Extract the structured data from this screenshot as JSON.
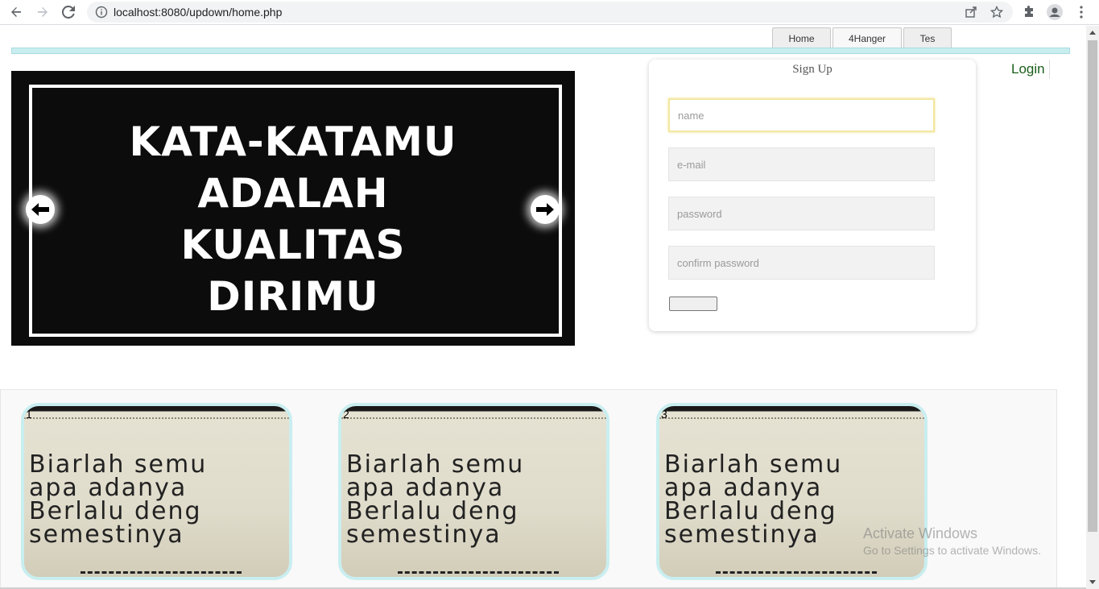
{
  "browser": {
    "url": "localhost:8080/updown/home.php"
  },
  "nav": {
    "tabs": [
      {
        "label": "Home"
      },
      {
        "label": "4Hanger"
      },
      {
        "label": "Tes"
      }
    ]
  },
  "slider": {
    "lines": [
      "KATA-KATAMU",
      "ADALAH",
      "KUALITAS",
      "DIRIMU"
    ]
  },
  "signup": {
    "title": "Sign Up",
    "fields": {
      "name_placeholder": "name",
      "email_placeholder": "e-mail",
      "password_placeholder": "password",
      "confirm_placeholder": "confirm password"
    },
    "submit_label": ""
  },
  "login_label": "Login",
  "gallery": {
    "items": [
      {
        "number": "1",
        "text": "Biarlah semu\napa adanya\nBerlalu deng\nsemestinya"
      },
      {
        "number": "2",
        "text": "Biarlah semu\napa adanya\nBerlalu deng\nsemestinya"
      },
      {
        "number": "3",
        "text": "Biarlah semu\napa adanya\nBerlalu deng\nsemestinya"
      }
    ]
  },
  "watermark": {
    "line1": "Activate Windows",
    "line2": "Go to Settings to activate Windows."
  },
  "colors": {
    "accent": "#c9eef0",
    "login": "#1a5e1a",
    "slider_bg": "#0c0c0c"
  }
}
